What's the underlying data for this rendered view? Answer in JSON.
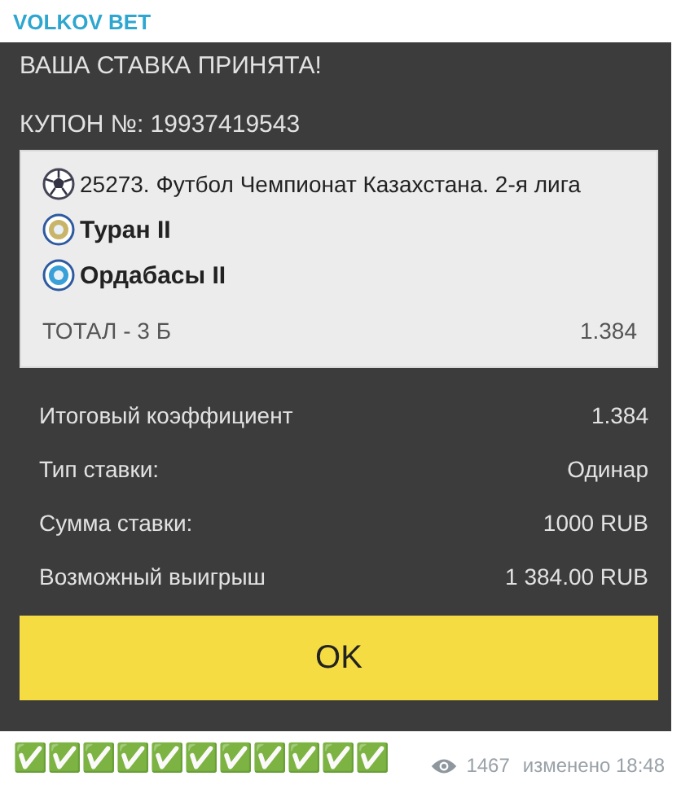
{
  "channel": {
    "name": "VOLKOV BET"
  },
  "bet": {
    "title": "ВАША СТАВКА ПРИНЯТА!",
    "coupon": "КУПОН №: 19937419543",
    "event": {
      "league": "25273. Футбол Чемпионат Казахстана. 2-я лига",
      "teams": [
        {
          "name": "Туран II"
        },
        {
          "name": "Ордабасы II"
        }
      ],
      "market": "ТОТАЛ - 3 Б",
      "odds": "1.384"
    },
    "summary": [
      {
        "label": "Итоговый коэффициент",
        "value": "1.384"
      },
      {
        "label": "Тип ставки:",
        "value": "Одинар"
      },
      {
        "label": "Сумма ставки:",
        "value": "1000 RUB"
      },
      {
        "label": "Возможный выигрыш",
        "value": "1 384.00 RUB"
      }
    ],
    "button": "OK"
  },
  "message_text": "✅✅✅✅✅✅✅✅✅✅✅",
  "footer": {
    "views": "1467",
    "edited": "изменено 18:48"
  }
}
